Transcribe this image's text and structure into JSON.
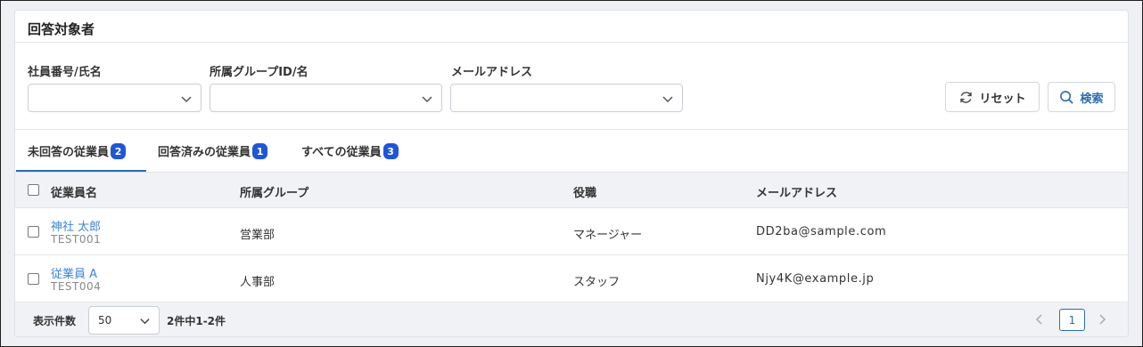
{
  "panel": {
    "title": "回答対象者"
  },
  "filters": {
    "employee_label": "社員番号/氏名",
    "group_label": "所属グループID/名",
    "email_label": "メールアドレス",
    "reset_label": "リセット",
    "search_label": "検索"
  },
  "tabs": [
    {
      "label": "未回答の従業員",
      "count": "2",
      "active": true
    },
    {
      "label": "回答済みの従業員",
      "count": "1",
      "active": false
    },
    {
      "label": "すべての従業員",
      "count": "3",
      "active": false
    }
  ],
  "table": {
    "headers": [
      "従業員名",
      "所属グループ",
      "役職",
      "メールアドレス"
    ],
    "rows": [
      {
        "name": "神社 太郎",
        "id": "TEST001",
        "group": "営業部",
        "role": "マネージャー",
        "email": "DD2ba@sample.com"
      },
      {
        "name": "従業員 A",
        "id": "TEST004",
        "group": "人事部",
        "role": "スタッフ",
        "email": "Njy4K@example.jp"
      }
    ]
  },
  "footer": {
    "page_size_label": "表示件数",
    "page_size_value": "50",
    "count_text": "2件中1-2件",
    "current_page": "1"
  },
  "colors": {
    "accent": "#2b6cb0",
    "badge": "#1f56d6",
    "link": "#3d85d8"
  },
  "icons": {
    "dropdown": "chevron-down-icon",
    "reset": "refresh-icon",
    "search": "search-icon",
    "prev": "chevron-left-icon",
    "next": "chevron-right-icon"
  }
}
